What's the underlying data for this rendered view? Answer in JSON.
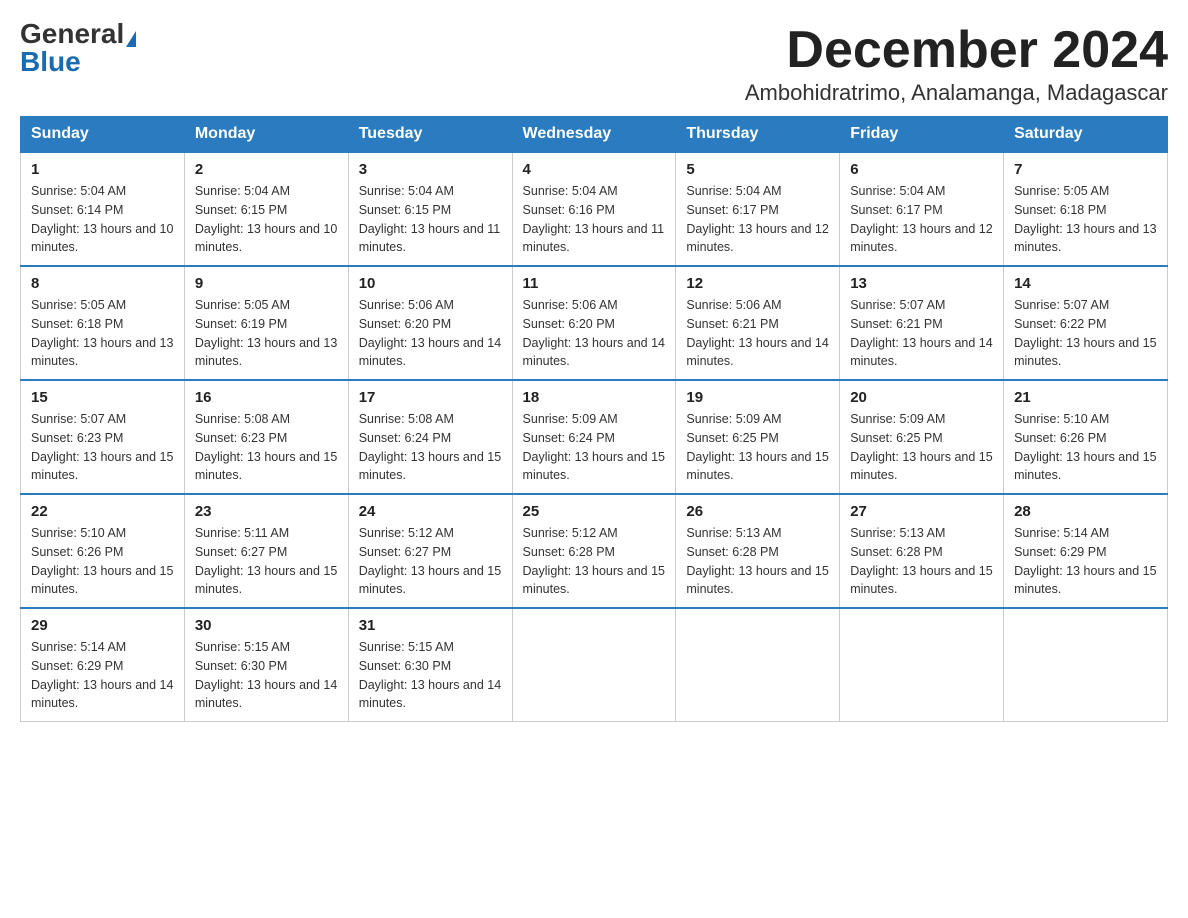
{
  "header": {
    "logo_general": "General",
    "logo_blue": "Blue",
    "month_title": "December 2024",
    "location": "Ambohidratrimo, Analamanga, Madagascar"
  },
  "days_of_week": [
    "Sunday",
    "Monday",
    "Tuesday",
    "Wednesday",
    "Thursday",
    "Friday",
    "Saturday"
  ],
  "weeks": [
    [
      {
        "day": 1,
        "sunrise": "5:04 AM",
        "sunset": "6:14 PM",
        "daylight": "13 hours and 10 minutes"
      },
      {
        "day": 2,
        "sunrise": "5:04 AM",
        "sunset": "6:15 PM",
        "daylight": "13 hours and 10 minutes"
      },
      {
        "day": 3,
        "sunrise": "5:04 AM",
        "sunset": "6:15 PM",
        "daylight": "13 hours and 11 minutes"
      },
      {
        "day": 4,
        "sunrise": "5:04 AM",
        "sunset": "6:16 PM",
        "daylight": "13 hours and 11 minutes"
      },
      {
        "day": 5,
        "sunrise": "5:04 AM",
        "sunset": "6:17 PM",
        "daylight": "13 hours and 12 minutes"
      },
      {
        "day": 6,
        "sunrise": "5:04 AM",
        "sunset": "6:17 PM",
        "daylight": "13 hours and 12 minutes"
      },
      {
        "day": 7,
        "sunrise": "5:05 AM",
        "sunset": "6:18 PM",
        "daylight": "13 hours and 13 minutes"
      }
    ],
    [
      {
        "day": 8,
        "sunrise": "5:05 AM",
        "sunset": "6:18 PM",
        "daylight": "13 hours and 13 minutes"
      },
      {
        "day": 9,
        "sunrise": "5:05 AM",
        "sunset": "6:19 PM",
        "daylight": "13 hours and 13 minutes"
      },
      {
        "day": 10,
        "sunrise": "5:06 AM",
        "sunset": "6:20 PM",
        "daylight": "13 hours and 14 minutes"
      },
      {
        "day": 11,
        "sunrise": "5:06 AM",
        "sunset": "6:20 PM",
        "daylight": "13 hours and 14 minutes"
      },
      {
        "day": 12,
        "sunrise": "5:06 AM",
        "sunset": "6:21 PM",
        "daylight": "13 hours and 14 minutes"
      },
      {
        "day": 13,
        "sunrise": "5:07 AM",
        "sunset": "6:21 PM",
        "daylight": "13 hours and 14 minutes"
      },
      {
        "day": 14,
        "sunrise": "5:07 AM",
        "sunset": "6:22 PM",
        "daylight": "13 hours and 15 minutes"
      }
    ],
    [
      {
        "day": 15,
        "sunrise": "5:07 AM",
        "sunset": "6:23 PM",
        "daylight": "13 hours and 15 minutes"
      },
      {
        "day": 16,
        "sunrise": "5:08 AM",
        "sunset": "6:23 PM",
        "daylight": "13 hours and 15 minutes"
      },
      {
        "day": 17,
        "sunrise": "5:08 AM",
        "sunset": "6:24 PM",
        "daylight": "13 hours and 15 minutes"
      },
      {
        "day": 18,
        "sunrise": "5:09 AM",
        "sunset": "6:24 PM",
        "daylight": "13 hours and 15 minutes"
      },
      {
        "day": 19,
        "sunrise": "5:09 AM",
        "sunset": "6:25 PM",
        "daylight": "13 hours and 15 minutes"
      },
      {
        "day": 20,
        "sunrise": "5:09 AM",
        "sunset": "6:25 PM",
        "daylight": "13 hours and 15 minutes"
      },
      {
        "day": 21,
        "sunrise": "5:10 AM",
        "sunset": "6:26 PM",
        "daylight": "13 hours and 15 minutes"
      }
    ],
    [
      {
        "day": 22,
        "sunrise": "5:10 AM",
        "sunset": "6:26 PM",
        "daylight": "13 hours and 15 minutes"
      },
      {
        "day": 23,
        "sunrise": "5:11 AM",
        "sunset": "6:27 PM",
        "daylight": "13 hours and 15 minutes"
      },
      {
        "day": 24,
        "sunrise": "5:12 AM",
        "sunset": "6:27 PM",
        "daylight": "13 hours and 15 minutes"
      },
      {
        "day": 25,
        "sunrise": "5:12 AM",
        "sunset": "6:28 PM",
        "daylight": "13 hours and 15 minutes"
      },
      {
        "day": 26,
        "sunrise": "5:13 AM",
        "sunset": "6:28 PM",
        "daylight": "13 hours and 15 minutes"
      },
      {
        "day": 27,
        "sunrise": "5:13 AM",
        "sunset": "6:28 PM",
        "daylight": "13 hours and 15 minutes"
      },
      {
        "day": 28,
        "sunrise": "5:14 AM",
        "sunset": "6:29 PM",
        "daylight": "13 hours and 15 minutes"
      }
    ],
    [
      {
        "day": 29,
        "sunrise": "5:14 AM",
        "sunset": "6:29 PM",
        "daylight": "13 hours and 14 minutes"
      },
      {
        "day": 30,
        "sunrise": "5:15 AM",
        "sunset": "6:30 PM",
        "daylight": "13 hours and 14 minutes"
      },
      {
        "day": 31,
        "sunrise": "5:15 AM",
        "sunset": "6:30 PM",
        "daylight": "13 hours and 14 minutes"
      },
      null,
      null,
      null,
      null
    ]
  ]
}
